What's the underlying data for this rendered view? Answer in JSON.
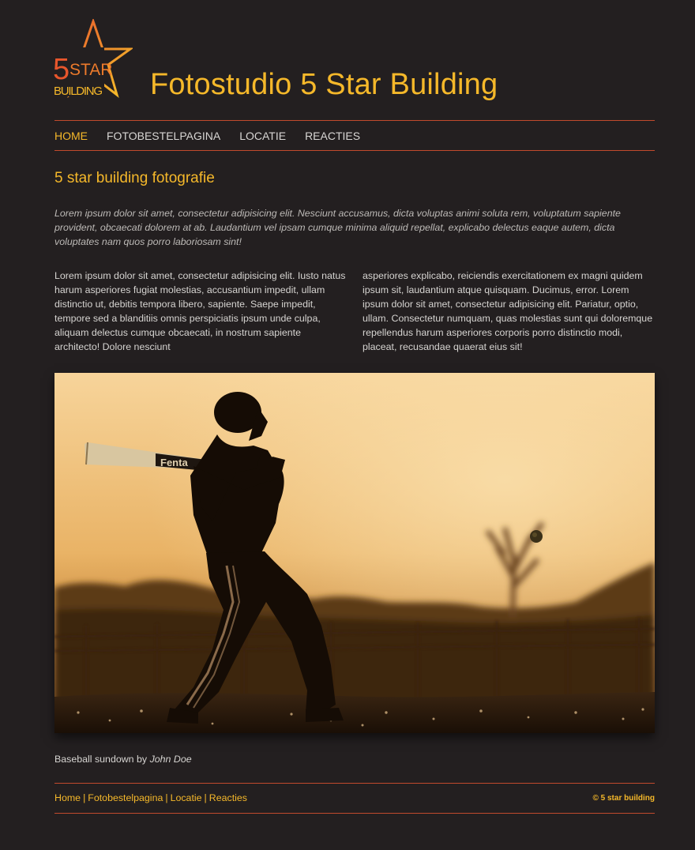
{
  "header": {
    "logo": {
      "line1": "5",
      "line2": "STAR",
      "line3": "BUILDING"
    },
    "site_title": "Fotostudio 5 Star Building"
  },
  "nav": {
    "items": [
      {
        "label": "HOME",
        "active": true
      },
      {
        "label": "FOTOBESTELPAGINA",
        "active": false
      },
      {
        "label": "LOCATIE",
        "active": false
      },
      {
        "label": "REACTIES",
        "active": false
      }
    ]
  },
  "main": {
    "heading": "5 star building fotografie",
    "intro": "Lorem ipsum dolor sit amet, consectetur adipisicing elit. Nesciunt accusamus, dicta voluptas animi soluta rem, voluptatum sapiente provident, obcaecati dolorem at ab. Laudantium vel ipsam cumque minima aliquid repellat, explicabo delectus eaque autem, dicta voluptates nam quos porro laboriosam sint!",
    "column_left": "Lorem ipsum dolor sit amet, consectetur adipisicing elit. Iusto natus harum asperiores fugiat molestias, accusantium impedit, ullam distinctio ut, debitis tempora libero, sapiente. Saepe impedit, tempore sed a blanditiis omnis perspiciatis ipsum unde culpa, aliquam delectus cumque obcaecati, in nostrum sapiente architecto! Dolore nesciunt",
    "column_right": "asperiores explicabo, reiciendis exercitationem ex magni quidem ipsum sit, laudantium atque quisquam. Ducimus, error. Lorem ipsum dolor sit amet, consectetur adipisicing elit. Pariatur, optio, ullam. Consectetur numquam, quas molestias sunt qui doloremque repellendus harum asperiores corporis porro distinctio modi, placeat, recusandae quaerat eius sit!",
    "photo": {
      "bat_text": "Fenta",
      "caption_text": "Baseball sundown by",
      "caption_author": "John Doe"
    }
  },
  "footer": {
    "links": [
      "Home",
      "Fotobestelpagina",
      "Locatie",
      "Reacties"
    ],
    "separator": "|",
    "copyright": "© 5 star building"
  },
  "colors": {
    "background": "#231f20",
    "accent": "#f5b82a",
    "rule": "#c14a2d",
    "text": "#d6d4d1"
  }
}
